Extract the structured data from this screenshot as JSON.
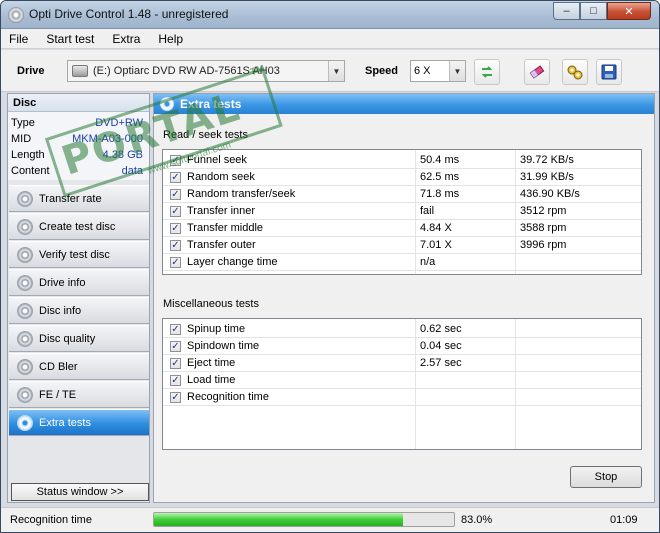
{
  "window": {
    "title": "Opti Drive Control 1.48 - unregistered",
    "controls": {
      "minimize": "‒",
      "maximize": "□",
      "close": "✕"
    }
  },
  "menu": {
    "items": [
      "File",
      "Start test",
      "Extra",
      "Help"
    ]
  },
  "toolbar": {
    "drive_label": "Drive",
    "drive_value": "(E:)   Optiarc DVD RW AD-7561S AH03",
    "speed_label": "Speed",
    "speed_value": "6 X",
    "buttons": [
      "refresh-icon",
      "eraser-icon",
      "settings-icon",
      "save-icon"
    ]
  },
  "disc": {
    "header": "Disc",
    "rows": [
      {
        "key": "Type",
        "value": "DVD+RW"
      },
      {
        "key": "MID",
        "value": "MKM-A03-000"
      },
      {
        "key": "Length",
        "value": "4.38 GB"
      },
      {
        "key": "Content",
        "value": "data"
      }
    ]
  },
  "nav": {
    "items": [
      {
        "label": "Transfer rate",
        "active": false
      },
      {
        "label": "Create test disc",
        "active": false
      },
      {
        "label": "Verify test disc",
        "active": false
      },
      {
        "label": "Drive info",
        "active": false
      },
      {
        "label": "Disc info",
        "active": false
      },
      {
        "label": "Disc quality",
        "active": false
      },
      {
        "label": "CD Bler",
        "active": false
      },
      {
        "label": "FE / TE",
        "active": false
      },
      {
        "label": "Extra tests",
        "active": true
      }
    ],
    "status_button": "Status window >>"
  },
  "panel": {
    "header": "Extra tests",
    "section1_title": "Read / seek tests",
    "section1_rows": [
      {
        "checked": true,
        "name": "Funnel seek",
        "value": "50.4 ms",
        "extra": "39.72 KB/s"
      },
      {
        "checked": true,
        "name": "Random seek",
        "value": "62.5 ms",
        "extra": "31.99 KB/s"
      },
      {
        "checked": true,
        "name": "Random transfer/seek",
        "value": "71.8 ms",
        "extra": "436.90 KB/s"
      },
      {
        "checked": true,
        "name": "Transfer inner",
        "value": "fail",
        "extra": "3512 rpm"
      },
      {
        "checked": true,
        "name": "Transfer middle",
        "value": "4.84 X",
        "extra": "3588 rpm"
      },
      {
        "checked": true,
        "name": "Transfer outer",
        "value": "7.01 X",
        "extra": "3996 rpm"
      },
      {
        "checked": true,
        "name": "Layer change time",
        "value": "n/a",
        "extra": ""
      }
    ],
    "section2_title": "Miscellaneous tests",
    "section2_rows": [
      {
        "checked": true,
        "name": "Spinup time",
        "value": "0.62 sec",
        "extra": ""
      },
      {
        "checked": true,
        "name": "Spindown time",
        "value": "0.04 sec",
        "extra": ""
      },
      {
        "checked": true,
        "name": "Eject time",
        "value": "2.57 sec",
        "extra": ""
      },
      {
        "checked": true,
        "name": "Load time",
        "value": "",
        "extra": ""
      },
      {
        "checked": true,
        "name": "Recognition time",
        "value": "",
        "extra": ""
      }
    ],
    "stop_button": "Stop"
  },
  "status": {
    "current_test": "Recognition time",
    "progress_percent": 83.0,
    "progress_text": "83.0%",
    "elapsed": "01:09"
  },
  "watermark": {
    "text": "PORTAL",
    "tm": "TM",
    "sub": "www.softportal.com"
  },
  "colors": {
    "accent": "#2f8ee0",
    "progress": "#3fcd38",
    "watermark": "#287837"
  }
}
